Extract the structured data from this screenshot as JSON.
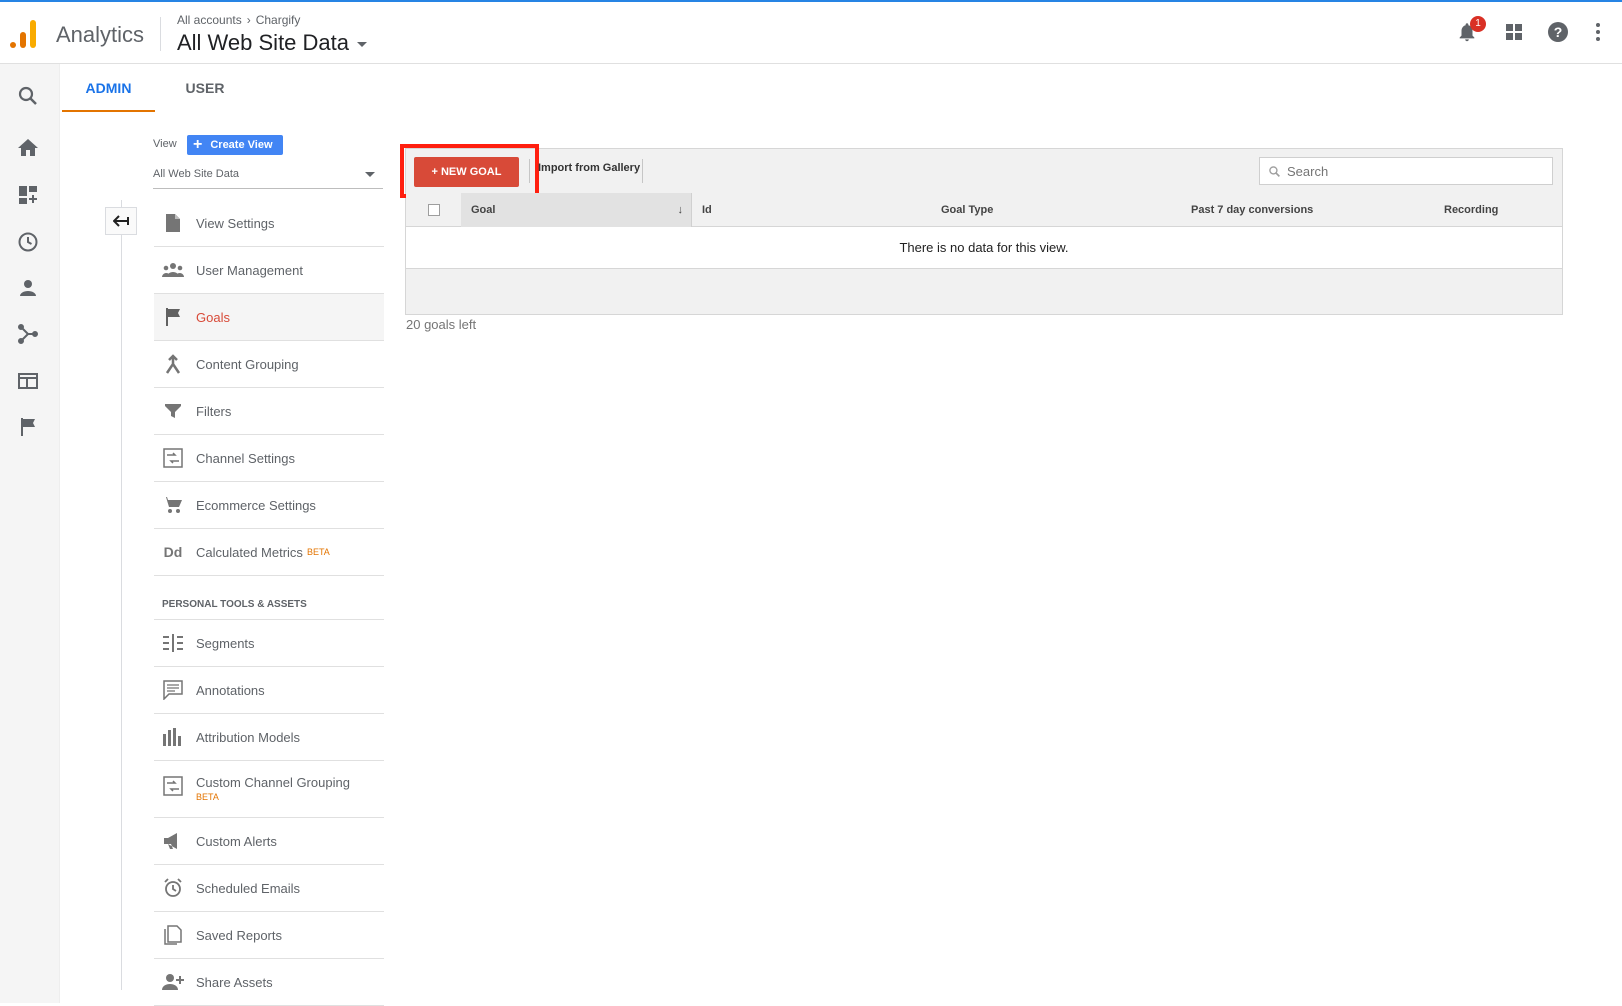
{
  "header": {
    "app_name": "Analytics",
    "breadcrumb": {
      "account": "All accounts",
      "separator_icon": "chevron-right-icon",
      "property": "Chargify"
    },
    "view_title": "All Web Site Data",
    "notifications_count": "1",
    "brand_colors": {
      "accent": "#e37400",
      "accent_light": "#f9ab00",
      "top_border": "#2684e4"
    }
  },
  "rail": {
    "icons": [
      "search-icon",
      "home-icon",
      "customization-icon",
      "realtime-icon",
      "audience-icon",
      "acquisition-icon",
      "behavior-icon",
      "conversions-icon"
    ]
  },
  "tabs": [
    {
      "label": "ADMIN",
      "active": true
    },
    {
      "label": "USER",
      "active": false
    }
  ],
  "view_section": {
    "label": "View",
    "create_button": "Create View",
    "selected_view": "All Web Site Data"
  },
  "menu": [
    {
      "label": "View Settings",
      "icon": "document-icon"
    },
    {
      "label": "User Management",
      "icon": "people-icon"
    },
    {
      "label": "Goals",
      "icon": "flag-icon",
      "active": true
    },
    {
      "label": "Content Grouping",
      "icon": "content-grouping-icon"
    },
    {
      "label": "Filters",
      "icon": "filter-icon"
    },
    {
      "label": "Channel Settings",
      "icon": "channel-icon"
    },
    {
      "label": "Ecommerce Settings",
      "icon": "cart-icon"
    },
    {
      "label": "Calculated Metrics",
      "icon": "dd-icon",
      "badge": "BETA"
    }
  ],
  "personal_section": {
    "heading": "PERSONAL TOOLS & ASSETS",
    "items": [
      {
        "label": "Segments",
        "icon": "segments-icon"
      },
      {
        "label": "Annotations",
        "icon": "annotations-icon"
      },
      {
        "label": "Attribution Models",
        "icon": "bar-chart-icon"
      },
      {
        "label": "Custom Channel Grouping",
        "icon": "channel-icon",
        "badge": "BETA"
      },
      {
        "label": "Custom Alerts",
        "icon": "megaphone-icon"
      },
      {
        "label": "Scheduled Emails",
        "icon": "alarm-icon"
      },
      {
        "label": "Saved Reports",
        "icon": "saved-reports-icon"
      },
      {
        "label": "Share Assets",
        "icon": "share-assets-icon"
      }
    ]
  },
  "goals": {
    "new_goal_button": "+ NEW GOAL",
    "import_button": "Import from Gallery",
    "search_placeholder": "Search",
    "columns": [
      "Goal",
      "Id",
      "Goal Type",
      "Past 7 day conversions",
      "Recording"
    ],
    "empty_message": "There is no data for this view.",
    "goals_left": "20 goals left",
    "highlight_color": "#ff1f0f",
    "button_color": "#d84a38"
  }
}
